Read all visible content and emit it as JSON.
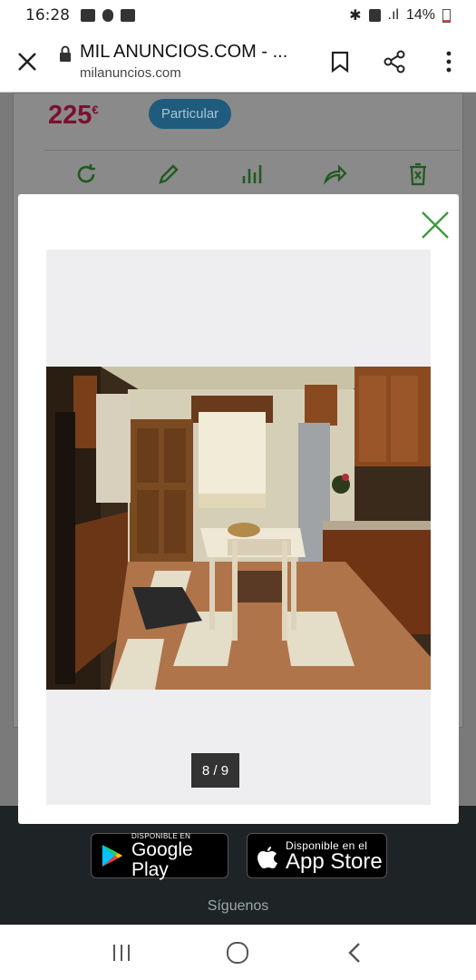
{
  "status_bar": {
    "time": "16:28",
    "battery": "14%"
  },
  "browser": {
    "title": "MIL ANUNCIOS.COM - ...",
    "domain": "milanuncios.com"
  },
  "listing": {
    "price": "225",
    "currency": "€",
    "seller_type": "Particular"
  },
  "gallery": {
    "counter": "8 / 9",
    "current": 8,
    "total": 9
  },
  "footer": {
    "google_play_small": "DISPONIBLE EN",
    "google_play_big": "Google Play",
    "app_store_small": "Disponible en el",
    "app_store_big": "App Store",
    "follow_label": "Síguenos"
  },
  "colors": {
    "accent_green": "#3c9a3c",
    "price": "#7a1030",
    "badge": "#1f5b7d",
    "footer_bg": "#1e2326"
  }
}
